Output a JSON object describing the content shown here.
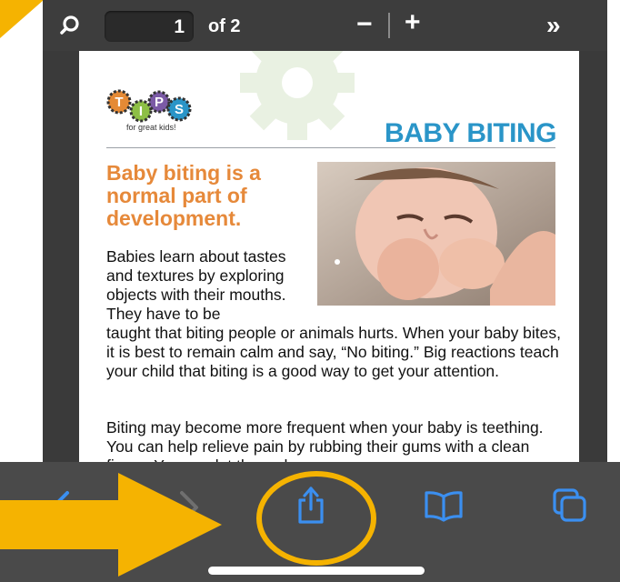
{
  "pdf_toolbar": {
    "current_page": "1",
    "page_of": "of 2",
    "zoom_out": "−",
    "zoom_in": "+",
    "more": "»"
  },
  "document": {
    "logo_letters": [
      "T",
      "I",
      "P",
      "S"
    ],
    "logo_tagline": "for great kids!",
    "title": "BABY BITING",
    "headline": "Baby biting is a normal part of development.",
    "para1_top": "Babies learn about tastes and textures by exploring objects with their mouths. They have to be",
    "para1_bottom": "taught that biting people or animals hurts. When your baby bites, it is best to remain calm and say, “No biting.” Big reactions teach your child that biting is a good way to get your attention.",
    "para2": "Biting may become more frequent when your baby is teething. You can help relieve pain by rubbing their gums with a clean finger. You can let them chew"
  },
  "bottom_toolbar": {
    "icons": [
      "back-icon",
      "forward-icon",
      "share-icon",
      "bookmarks-icon",
      "tabs-icon"
    ],
    "accent": "#3b8ff0"
  },
  "annotation": {
    "color": "#f5b301"
  }
}
